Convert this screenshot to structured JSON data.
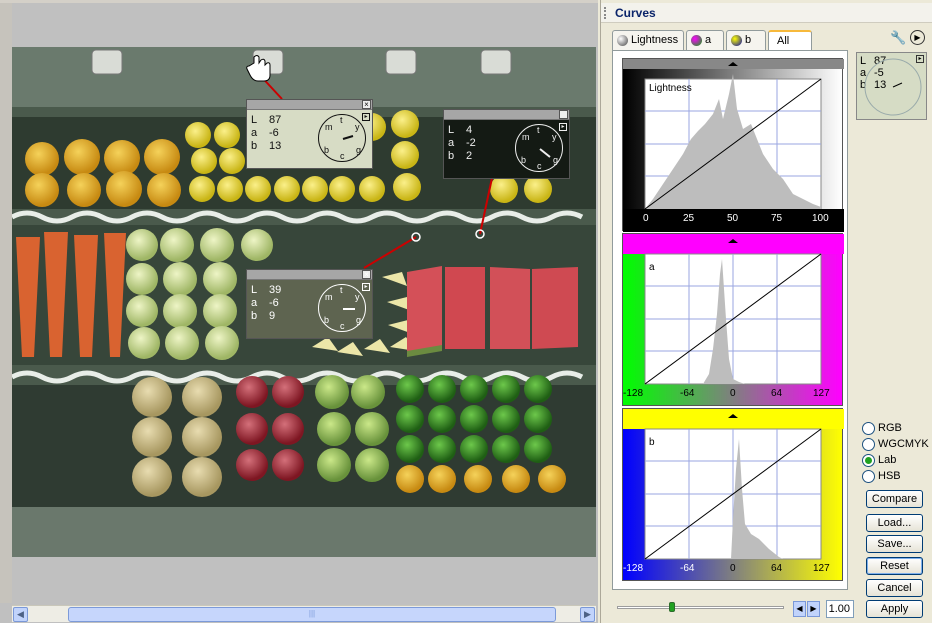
{
  "panel": {
    "title": "Curves",
    "tabs": [
      {
        "label": "Lightness"
      },
      {
        "label": "a"
      },
      {
        "label": "b"
      },
      {
        "label": "All"
      }
    ],
    "colorspaces": [
      "RGB",
      "WGCMYK",
      "Lab",
      "HSB"
    ],
    "selected_colorspace": "Lab",
    "buttons": {
      "compare": "Compare",
      "load": "Load...",
      "save": "Save...",
      "reset": "Reset",
      "cancel": "Cancel",
      "apply": "Apply"
    },
    "zoom_value": "1.00",
    "slider_value": 0.33
  },
  "curves": {
    "lightness": {
      "label": "Lightness",
      "ticks": [
        "0",
        "25",
        "50",
        "75",
        "100"
      ]
    },
    "a": {
      "label": "a",
      "ticks": [
        "-128",
        "-64",
        "0",
        "64",
        "127"
      ]
    },
    "b": {
      "label": "b",
      "ticks": [
        "-128",
        "-64",
        "0",
        "64",
        "127"
      ]
    }
  },
  "mini_readout": {
    "L": "87",
    "a": "-5",
    "b": "13",
    "L_label": "L",
    "a_label": "a",
    "b_label": "b"
  },
  "probes": [
    {
      "L": "87",
      "a": "-6",
      "b": "13",
      "L_label": "L",
      "a_label": "a",
      "b_label": "b"
    },
    {
      "L": "4",
      "a": "-2",
      "b": "2",
      "L_label": "L",
      "a_label": "a",
      "b_label": "b"
    },
    {
      "L": "39",
      "a": "-6",
      "b": "9",
      "L_label": "L",
      "a_label": "a",
      "b_label": "b"
    }
  ],
  "dial_letters": {
    "m": "m",
    "t": "t",
    "y": "y",
    "b": "b",
    "c": "c",
    "g": "g"
  },
  "colors": {
    "accent_tab": "#f7b93b",
    "radio_on": "#21a121",
    "a_channel": "#ff00ff",
    "b_channel": "#ffff00",
    "probe_line": "#cc0000"
  }
}
